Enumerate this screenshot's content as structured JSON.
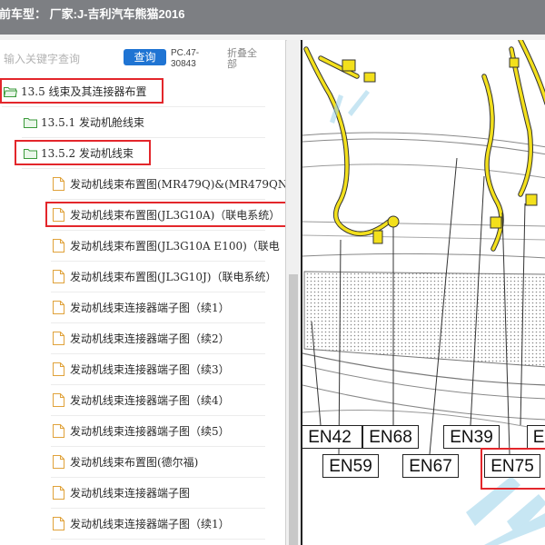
{
  "title_bar": {
    "text": "前车型：  厂家:J-吉利汽车熊猫2016"
  },
  "search": {
    "placeholder": "输入关键字查询",
    "query_button": "查询",
    "pc_code_line1": "PC.47-",
    "pc_code_line2": "30843",
    "collapse_line1": "折叠全",
    "collapse_line2": "部"
  },
  "tree": {
    "items": [
      {
        "label": "13.5 线束及其连接器布置",
        "icon": "folder-open-icon",
        "highlighted": true
      },
      {
        "label": "13.5.1 发动机舱线束",
        "icon": "folder-icon",
        "highlighted": false
      },
      {
        "label": "13.5.2 发动机线束",
        "icon": "folder-icon",
        "highlighted": true
      },
      {
        "label": "发动机线束布置图(MR479Q)&(MR479QN",
        "icon": "document-icon",
        "highlighted": false
      },
      {
        "label": "发动机线束布置图(JL3G10A)（联电系统）",
        "icon": "document-icon",
        "highlighted": true
      },
      {
        "label": "发动机线束布置图(JL3G10A E100)（联电",
        "icon": "document-icon",
        "highlighted": false
      },
      {
        "label": "发动机线束布置图(JL3G10J)（联电系统）",
        "icon": "document-icon",
        "highlighted": false
      },
      {
        "label": "发动机线束连接器端子图（续1）",
        "icon": "document-icon",
        "highlighted": false
      },
      {
        "label": "发动机线束连接器端子图（续2）",
        "icon": "document-icon",
        "highlighted": false
      },
      {
        "label": "发动机线束连接器端子图（续3）",
        "icon": "document-icon",
        "highlighted": false
      },
      {
        "label": "发动机线束连接器端子图（续4）",
        "icon": "document-icon",
        "highlighted": false
      },
      {
        "label": "发动机线束连接器端子图（续5）",
        "icon": "document-icon",
        "highlighted": false
      },
      {
        "label": "发动机线束布置图(德尔福)",
        "icon": "document-icon",
        "highlighted": false
      },
      {
        "label": "发动机线束连接器端子图",
        "icon": "document-icon",
        "highlighted": false
      },
      {
        "label": "发动机线束连接器端子图（续1）",
        "icon": "document-icon",
        "highlighted": false
      },
      {
        "label": "发动机线束布置图",
        "icon": "document-icon",
        "highlighted": false
      }
    ]
  },
  "diagram": {
    "connectors_row1": [
      "EN42",
      "EN68",
      "EN39",
      "EN"
    ],
    "connectors_row2": [
      "EN59",
      "EN67",
      "EN75"
    ],
    "highlighted_connector": "EN75",
    "harness_color": "#f3e01c",
    "highlight_color": "#e3262b",
    "accent_color": "#1f74d3"
  }
}
